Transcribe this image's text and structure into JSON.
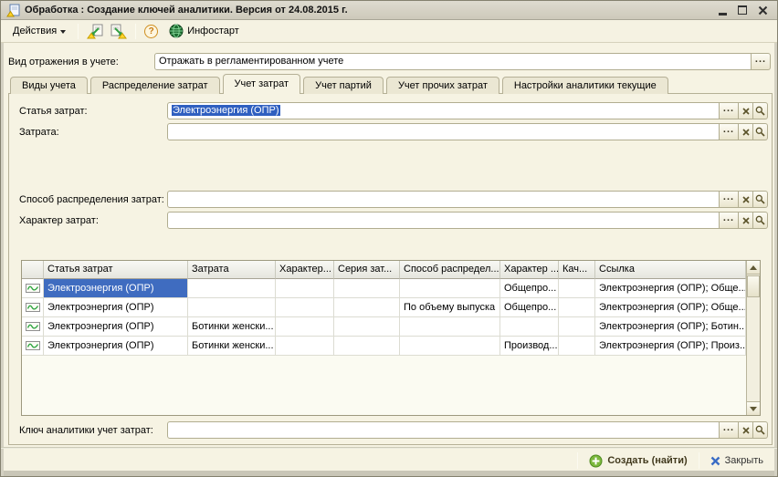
{
  "window": {
    "title": "Обработка : Создание ключей аналитики. Версия от 24.08.2015 г."
  },
  "toolbar": {
    "actions_label": "Действия",
    "infostart_label": "Инфостарт"
  },
  "icons": {
    "ellipsis": "...",
    "question": "?"
  },
  "reflection_field": {
    "label": "Вид отражения в учете:",
    "value": "Отражать в регламентированном учете"
  },
  "tabs": [
    {
      "label": "Виды учета"
    },
    {
      "label": "Распределение затрат"
    },
    {
      "label": "Учет затрат"
    },
    {
      "label": "Учет партий"
    },
    {
      "label": "Учет прочих затрат"
    },
    {
      "label": "Настройки аналитики текущие"
    }
  ],
  "panel": {
    "cost_item": {
      "label": "Статья затрат:",
      "value": "Электроэнергия (ОПР)"
    },
    "cost": {
      "label": "Затрата:",
      "value": ""
    },
    "distribution_method": {
      "label": "Способ распределения затрат:",
      "value": ""
    },
    "cost_nature": {
      "label": "Характер затрат:",
      "value": ""
    },
    "analytics_key": {
      "label": "Ключ аналитики учет затрат:",
      "value": ""
    }
  },
  "table": {
    "columns": [
      "Статья затрат",
      "Затрата",
      "Характер...",
      "Серия зат...",
      "Способ распредел...",
      "Характер ...",
      "Кач...",
      "Ссылка"
    ],
    "rows": [
      [
        "Электроэнергия (ОПР)",
        "",
        "",
        "",
        "",
        "Общепро...",
        "",
        "Электроэнергия (ОПР); Обще..."
      ],
      [
        "Электроэнергия (ОПР)",
        "",
        "",
        "",
        "По объему выпуска",
        "Общепро...",
        "",
        "Электроэнергия (ОПР); Обще..."
      ],
      [
        "Электроэнергия (ОПР)",
        "Ботинки женски...",
        "",
        "",
        "",
        "",
        "",
        "Электроэнергия (ОПР); Ботин..."
      ],
      [
        "Электроэнергия (ОПР)",
        "Ботинки женски...",
        "",
        "",
        "",
        "Производ...",
        "",
        "Электроэнергия (ОПР); Произ..."
      ]
    ]
  },
  "footer": {
    "create_label": "Создать (найти)",
    "close_label": "Закрыть"
  }
}
